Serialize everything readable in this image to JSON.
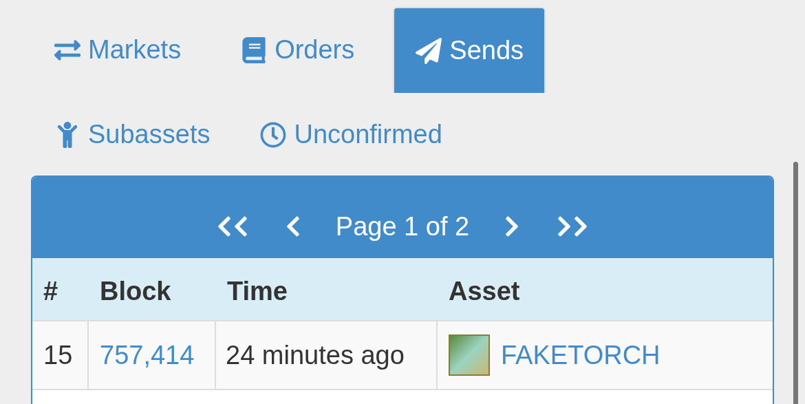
{
  "tabs": [
    {
      "label": "Markets",
      "kind": "exchange",
      "selected": false
    },
    {
      "label": "Orders",
      "kind": "book",
      "selected": false
    },
    {
      "label": "Sends",
      "kind": "plane",
      "selected": true
    },
    {
      "label": "Subassets",
      "kind": "child",
      "selected": false
    },
    {
      "label": "Unconfirmed",
      "kind": "clock",
      "selected": false
    }
  ],
  "pagination": {
    "label": "Page 1 of 2"
  },
  "table": {
    "columns": [
      "#",
      "Block",
      "Time",
      "Asset"
    ],
    "rows": [
      {
        "num": "15",
        "block": "757,414",
        "time": "24 minutes ago",
        "asset": "FAKETORCH"
      }
    ]
  }
}
